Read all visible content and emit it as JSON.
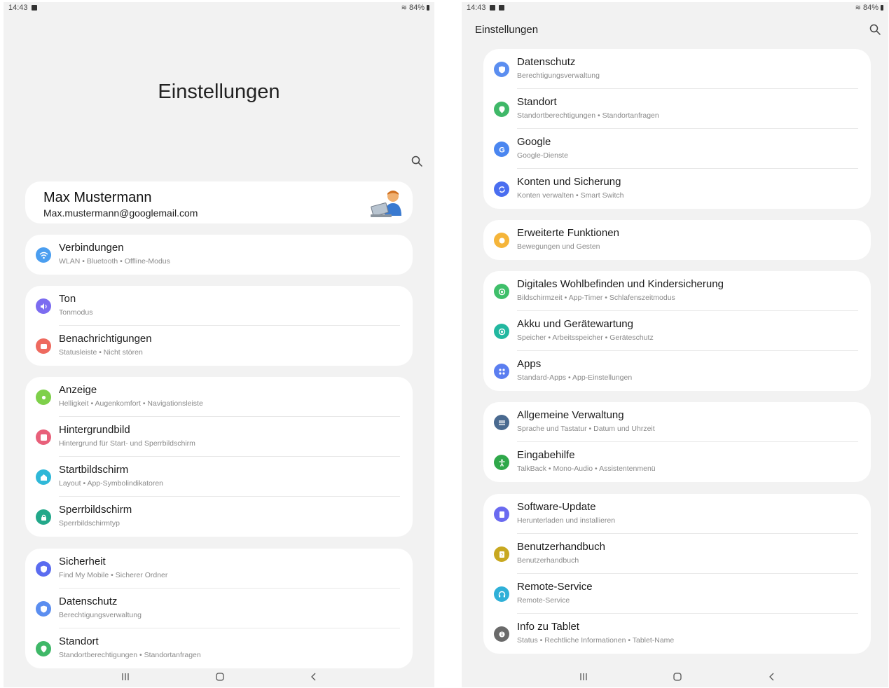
{
  "left": {
    "status": {
      "time": "14:43",
      "battery": "84%"
    },
    "title": "Einstellungen",
    "profile": {
      "name": "Max Mustermann",
      "email": "Max.mustermann@googlemail.com"
    },
    "groups": [
      {
        "items": [
          {
            "title": "Verbindungen",
            "subtitle": "WLAN  •  Bluetooth  •  Offline-Modus",
            "icon": "wifi-icon",
            "color": "#4a9ef0"
          }
        ]
      },
      {
        "items": [
          {
            "title": "Ton",
            "subtitle": "Tonmodus",
            "icon": "sound-icon",
            "color": "#7c6cf0"
          },
          {
            "title": "Benachrichtigungen",
            "subtitle": "Statusleiste  •  Nicht stören",
            "icon": "notification-icon",
            "color": "#ee6a5f"
          }
        ]
      },
      {
        "items": [
          {
            "title": "Anzeige",
            "subtitle": "Helligkeit  •  Augenkomfort  •  Navigationsleiste",
            "icon": "display-icon",
            "color": "#7ed04a"
          },
          {
            "title": "Hintergrundbild",
            "subtitle": "Hintergrund für Start- und Sperrbildschirm",
            "icon": "wallpaper-icon",
            "color": "#e8607a"
          },
          {
            "title": "Startbildschirm",
            "subtitle": "Layout  •  App-Symbolindikatoren",
            "icon": "home-icon",
            "color": "#2fb8d8"
          },
          {
            "title": "Sperrbildschirm",
            "subtitle": "Sperrbildschirmtyp",
            "icon": "lock-icon",
            "color": "#22a88a"
          }
        ]
      },
      {
        "items": [
          {
            "title": "Sicherheit",
            "subtitle": "Find My Mobile  •  Sicherer Ordner",
            "icon": "shield-icon",
            "color": "#5b6cf0"
          },
          {
            "title": "Datenschutz",
            "subtitle": "Berechtigungsverwaltung",
            "icon": "privacy-icon",
            "color": "#5b8ef0"
          },
          {
            "title": "Standort",
            "subtitle": "Standortberechtigungen  •  Standortanfragen",
            "icon": "location-icon",
            "color": "#3fb868"
          }
        ]
      }
    ]
  },
  "right": {
    "status": {
      "time": "14:43",
      "battery": "84%"
    },
    "title": "Einstellungen",
    "groups": [
      {
        "items": [
          {
            "title": "Datenschutz",
            "subtitle": "Berechtigungsverwaltung",
            "icon": "privacy-icon",
            "color": "#5b8ef0"
          },
          {
            "title": "Standort",
            "subtitle": "Standortberechtigungen  •  Standortanfragen",
            "icon": "location-icon",
            "color": "#3fb868"
          },
          {
            "title": "Google",
            "subtitle": "Google-Dienste",
            "icon": "google-icon",
            "color": "#4a86f0"
          },
          {
            "title": "Konten und Sicherung",
            "subtitle": "Konten verwalten  •  Smart Switch",
            "icon": "sync-icon",
            "color": "#4a6ef0"
          }
        ]
      },
      {
        "items": [
          {
            "title": "Erweiterte Funktionen",
            "subtitle": "Bewegungen und Gesten",
            "icon": "gear-plus-icon",
            "color": "#f5b53a"
          }
        ]
      },
      {
        "items": [
          {
            "title": "Digitales Wohlbefinden und Kindersicherung",
            "subtitle": "Bildschirmzeit  •  App-Timer  •  Schlafenszeitmodus",
            "icon": "wellbeing-icon",
            "color": "#3fbf6a"
          },
          {
            "title": "Akku und Gerätewartung",
            "subtitle": "Speicher  •  Arbeitsspeicher  •  Geräteschutz",
            "icon": "battery-care-icon",
            "color": "#22b8a0"
          },
          {
            "title": "Apps",
            "subtitle": "Standard-Apps  •  App-Einstellungen",
            "icon": "apps-icon",
            "color": "#5b7ef0"
          }
        ]
      },
      {
        "items": [
          {
            "title": "Allgemeine Verwaltung",
            "subtitle": "Sprache und Tastatur  •  Datum und Uhrzeit",
            "icon": "sliders-icon",
            "color": "#4a6a90"
          },
          {
            "title": "Eingabehilfe",
            "subtitle": "TalkBack  •  Mono-Audio  •  Assistentenmenü",
            "icon": "accessibility-icon",
            "color": "#2fa84a"
          }
        ]
      },
      {
        "items": [
          {
            "title": "Software-Update",
            "subtitle": "Herunterladen und installieren",
            "icon": "update-icon",
            "color": "#6a6af0"
          },
          {
            "title": "Benutzerhandbuch",
            "subtitle": "Benutzerhandbuch",
            "icon": "manual-icon",
            "color": "#c8a820"
          },
          {
            "title": "Remote-Service",
            "subtitle": "Remote-Service",
            "icon": "headset-icon",
            "color": "#2fb0d8"
          },
          {
            "title": "Info zu Tablet",
            "subtitle": "Status  •  Rechtliche Informationen  •  Tablet-Name",
            "icon": "info-icon",
            "color": "#6a6a6a"
          }
        ]
      }
    ]
  }
}
